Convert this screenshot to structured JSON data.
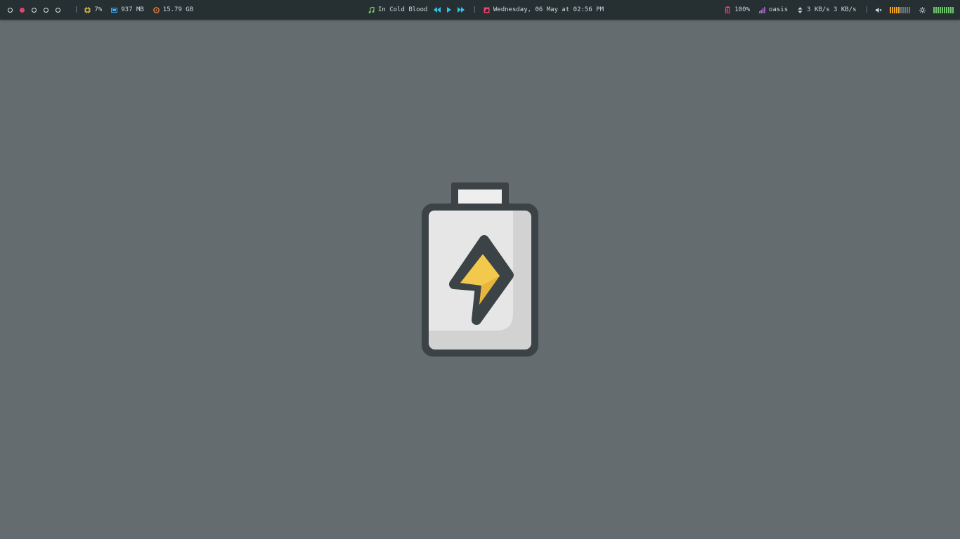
{
  "workspaces": [
    {
      "active": false
    },
    {
      "active": true
    },
    {
      "active": false
    },
    {
      "active": false
    },
    {
      "active": false
    }
  ],
  "separator": "|",
  "system": {
    "cpu": "7%",
    "memory": "937 MB",
    "disk": "15.79 GB"
  },
  "music": {
    "track": "In Cold Blood"
  },
  "date": {
    "text": "Wednesday, 06 May at 02:56 PM"
  },
  "status": {
    "battery": "100%",
    "network_name": "oasis",
    "network_speed": "3 KB/s 3 KB/s"
  },
  "volume_level": 0.5,
  "brightness_level": 1.0,
  "colors": {
    "bar_bg": "#263033",
    "desktop_bg": "#656c6f",
    "accent_red": "#e8446d",
    "cpu_yellow": "#f2c94c",
    "memory_blue": "#3fa9f5",
    "disk_orange": "#ef7d3a",
    "music_green": "#7bd36a",
    "media_cyan": "#2ec4e8",
    "wifi_purple": "#b86bd6",
    "volume_orange": "#f0a526",
    "brightness_green": "#6cc76a"
  },
  "icons": {
    "cpu": "cpu-icon",
    "memory": "memory-icon",
    "disk": "disk-icon",
    "music": "music-note-icon",
    "calendar": "calendar-icon",
    "battery": "battery-icon",
    "wifi": "signal-icon",
    "network": "up-down-arrows-icon",
    "volume": "volume-icon",
    "brightness": "brightness-icon",
    "wallpaper": "charging-battery-icon"
  }
}
